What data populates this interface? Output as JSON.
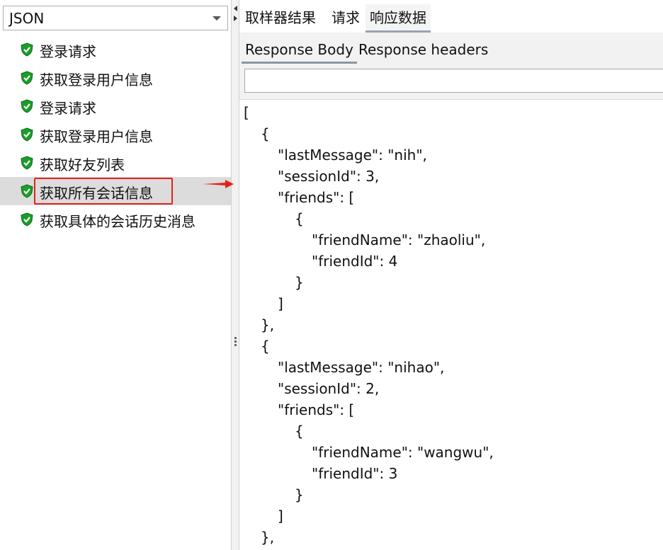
{
  "renderer": {
    "selected": "JSON"
  },
  "tree": {
    "items": [
      {
        "label": "登录请求",
        "status": "success"
      },
      {
        "label": "获取登录用户信息",
        "status": "success"
      },
      {
        "label": "登录请求",
        "status": "success"
      },
      {
        "label": "获取登录用户信息",
        "status": "success"
      },
      {
        "label": "获取好友列表",
        "status": "success"
      },
      {
        "label": "获取所有会话信息",
        "status": "success",
        "selected": true
      },
      {
        "label": "获取具体的会话历史消息",
        "status": "success"
      }
    ]
  },
  "tabs": [
    {
      "label": "取样器结果"
    },
    {
      "label": "请求"
    },
    {
      "label": "响应数据",
      "active": true
    }
  ],
  "subtabs": [
    {
      "label": "Response Body",
      "active": true
    },
    {
      "label": "Response headers"
    }
  ],
  "search": {
    "value": "",
    "placeholder": ""
  },
  "response_body": {
    "lines": [
      "[",
      "{",
      "\"lastMessage\": \"nih\",",
      "\"sessionId\": 3,",
      "\"friends\": [",
      "{",
      "\"friendName\": \"zhaoliu\",",
      "\"friendId\": 4",
      "}",
      "]",
      "},",
      "{",
      "\"lastMessage\": \"nihao\",",
      "\"sessionId\": 2,",
      "\"friends\": [",
      "{",
      "\"friendName\": \"wangwu\",",
      "\"friendId\": 3",
      "}",
      "]",
      "},"
    ]
  },
  "icons": {
    "status_icon": "green-shield-check-icon",
    "pointer": "red-arrow-icon"
  },
  "colors": {
    "success": "#1a9e2a",
    "highlight": "#e8201b",
    "selected_bg": "#dcdcdc"
  }
}
